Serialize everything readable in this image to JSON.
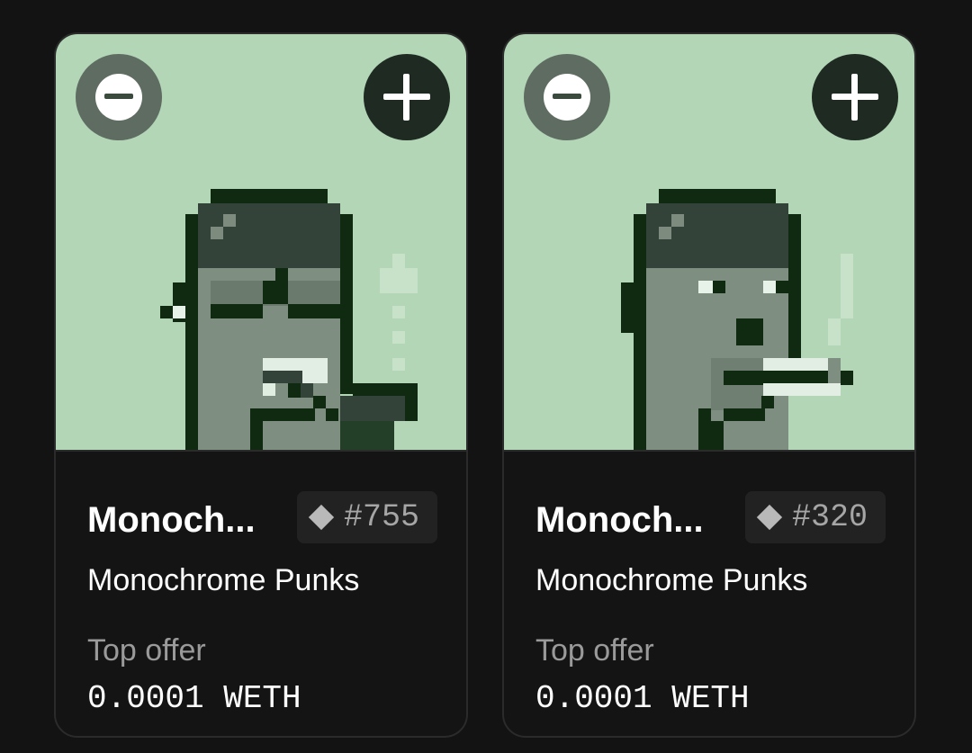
{
  "cards": [
    {
      "name": "Monoch...",
      "token_id": "#755",
      "collection": "Monochrome Punks",
      "offer_label": "Top offer",
      "offer_value": "0.0001 WETH"
    },
    {
      "name": "Monoch...",
      "token_id": "#320",
      "collection": "Monochrome Punks",
      "offer_label": "Top offer",
      "offer_value": "0.0001 WETH"
    }
  ],
  "colors": {
    "page_background": "#131313",
    "card_background": "#141414",
    "art_background": "#b2d6b6",
    "add_button": "#1f2b22",
    "remove_button": "#5f6c62"
  },
  "icons": {
    "remove": "minus-circle-icon",
    "add": "plus-icon",
    "token": "diamond-icon"
  }
}
